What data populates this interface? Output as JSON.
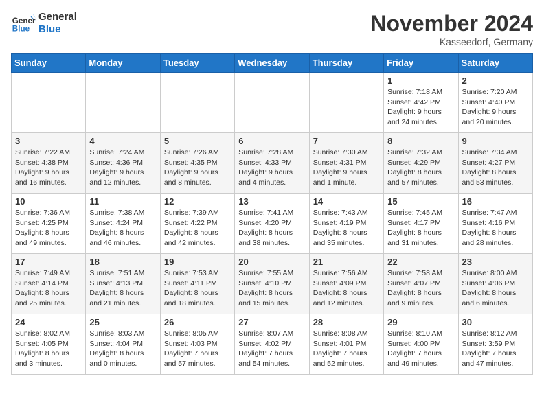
{
  "logo": {
    "text_general": "General",
    "text_blue": "Blue"
  },
  "title": "November 2024",
  "location": "Kasseedorf, Germany",
  "days_header": [
    "Sunday",
    "Monday",
    "Tuesday",
    "Wednesday",
    "Thursday",
    "Friday",
    "Saturday"
  ],
  "weeks": [
    [
      {
        "day": "",
        "info": ""
      },
      {
        "day": "",
        "info": ""
      },
      {
        "day": "",
        "info": ""
      },
      {
        "day": "",
        "info": ""
      },
      {
        "day": "",
        "info": ""
      },
      {
        "day": "1",
        "info": "Sunrise: 7:18 AM\nSunset: 4:42 PM\nDaylight: 9 hours\nand 24 minutes."
      },
      {
        "day": "2",
        "info": "Sunrise: 7:20 AM\nSunset: 4:40 PM\nDaylight: 9 hours\nand 20 minutes."
      }
    ],
    [
      {
        "day": "3",
        "info": "Sunrise: 7:22 AM\nSunset: 4:38 PM\nDaylight: 9 hours\nand 16 minutes."
      },
      {
        "day": "4",
        "info": "Sunrise: 7:24 AM\nSunset: 4:36 PM\nDaylight: 9 hours\nand 12 minutes."
      },
      {
        "day": "5",
        "info": "Sunrise: 7:26 AM\nSunset: 4:35 PM\nDaylight: 9 hours\nand 8 minutes."
      },
      {
        "day": "6",
        "info": "Sunrise: 7:28 AM\nSunset: 4:33 PM\nDaylight: 9 hours\nand 4 minutes."
      },
      {
        "day": "7",
        "info": "Sunrise: 7:30 AM\nSunset: 4:31 PM\nDaylight: 9 hours\nand 1 minute."
      },
      {
        "day": "8",
        "info": "Sunrise: 7:32 AM\nSunset: 4:29 PM\nDaylight: 8 hours\nand 57 minutes."
      },
      {
        "day": "9",
        "info": "Sunrise: 7:34 AM\nSunset: 4:27 PM\nDaylight: 8 hours\nand 53 minutes."
      }
    ],
    [
      {
        "day": "10",
        "info": "Sunrise: 7:36 AM\nSunset: 4:25 PM\nDaylight: 8 hours\nand 49 minutes."
      },
      {
        "day": "11",
        "info": "Sunrise: 7:38 AM\nSunset: 4:24 PM\nDaylight: 8 hours\nand 46 minutes."
      },
      {
        "day": "12",
        "info": "Sunrise: 7:39 AM\nSunset: 4:22 PM\nDaylight: 8 hours\nand 42 minutes."
      },
      {
        "day": "13",
        "info": "Sunrise: 7:41 AM\nSunset: 4:20 PM\nDaylight: 8 hours\nand 38 minutes."
      },
      {
        "day": "14",
        "info": "Sunrise: 7:43 AM\nSunset: 4:19 PM\nDaylight: 8 hours\nand 35 minutes."
      },
      {
        "day": "15",
        "info": "Sunrise: 7:45 AM\nSunset: 4:17 PM\nDaylight: 8 hours\nand 31 minutes."
      },
      {
        "day": "16",
        "info": "Sunrise: 7:47 AM\nSunset: 4:16 PM\nDaylight: 8 hours\nand 28 minutes."
      }
    ],
    [
      {
        "day": "17",
        "info": "Sunrise: 7:49 AM\nSunset: 4:14 PM\nDaylight: 8 hours\nand 25 minutes."
      },
      {
        "day": "18",
        "info": "Sunrise: 7:51 AM\nSunset: 4:13 PM\nDaylight: 8 hours\nand 21 minutes."
      },
      {
        "day": "19",
        "info": "Sunrise: 7:53 AM\nSunset: 4:11 PM\nDaylight: 8 hours\nand 18 minutes."
      },
      {
        "day": "20",
        "info": "Sunrise: 7:55 AM\nSunset: 4:10 PM\nDaylight: 8 hours\nand 15 minutes."
      },
      {
        "day": "21",
        "info": "Sunrise: 7:56 AM\nSunset: 4:09 PM\nDaylight: 8 hours\nand 12 minutes."
      },
      {
        "day": "22",
        "info": "Sunrise: 7:58 AM\nSunset: 4:07 PM\nDaylight: 8 hours\nand 9 minutes."
      },
      {
        "day": "23",
        "info": "Sunrise: 8:00 AM\nSunset: 4:06 PM\nDaylight: 8 hours\nand 6 minutes."
      }
    ],
    [
      {
        "day": "24",
        "info": "Sunrise: 8:02 AM\nSunset: 4:05 PM\nDaylight: 8 hours\nand 3 minutes."
      },
      {
        "day": "25",
        "info": "Sunrise: 8:03 AM\nSunset: 4:04 PM\nDaylight: 8 hours\nand 0 minutes."
      },
      {
        "day": "26",
        "info": "Sunrise: 8:05 AM\nSunset: 4:03 PM\nDaylight: 7 hours\nand 57 minutes."
      },
      {
        "day": "27",
        "info": "Sunrise: 8:07 AM\nSunset: 4:02 PM\nDaylight: 7 hours\nand 54 minutes."
      },
      {
        "day": "28",
        "info": "Sunrise: 8:08 AM\nSunset: 4:01 PM\nDaylight: 7 hours\nand 52 minutes."
      },
      {
        "day": "29",
        "info": "Sunrise: 8:10 AM\nSunset: 4:00 PM\nDaylight: 7 hours\nand 49 minutes."
      },
      {
        "day": "30",
        "info": "Sunrise: 8:12 AM\nSunset: 3:59 PM\nDaylight: 7 hours\nand 47 minutes."
      }
    ]
  ]
}
